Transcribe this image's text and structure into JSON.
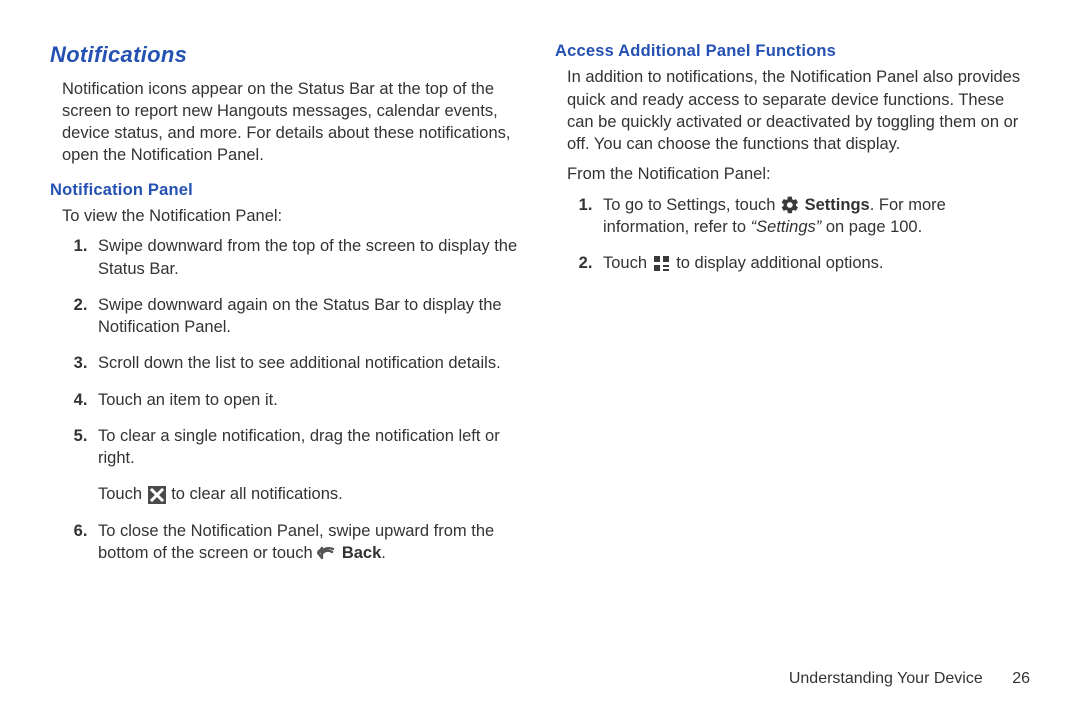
{
  "left": {
    "title": "Notifications",
    "intro": "Notification icons appear on the Status Bar at the top of the screen to report new Hangouts messages, calendar events, device status, and more. For details about these notifications, open the Notification Panel.",
    "sub": "Notification Panel",
    "view_line": "To view the Notification Panel:",
    "step1": "Swipe downward from the top of the screen to display the Status Bar.",
    "step2": "Swipe downward again on the Status Bar to display the Notification Panel.",
    "step3": "Scroll down the list to see additional notification details.",
    "step4": "Touch an item to open it.",
    "step5": "To clear a single notification, drag the notification left or right.",
    "step5b_pre": "Touch ",
    "step5b_post": " to clear all notifications.",
    "step6_pre": "To close the Notification Panel, swipe upward from the bottom of the screen or touch ",
    "step6_back": "Back",
    "step6_post": "."
  },
  "right": {
    "sub": "Access Additional Panel Functions",
    "intro": "In addition to notifications, the Notification Panel also provides quick and ready access to separate device functions. These can be quickly activated or deactivated by toggling them on or off. You can choose the functions that display.",
    "from_line": "From the Notification Panel:",
    "r1_pre": "To go to Settings, touch ",
    "r1_settings": "Settings",
    "r1_mid": ". For more information, refer to ",
    "r1_ref": "“Settings”",
    "r1_post_on": " on page ",
    "r1_page": "100",
    "r1_end": ".",
    "r2_pre": "Touch ",
    "r2_post": " to display additional options."
  },
  "footer": {
    "chapter": "Understanding Your Device",
    "page": "26"
  }
}
